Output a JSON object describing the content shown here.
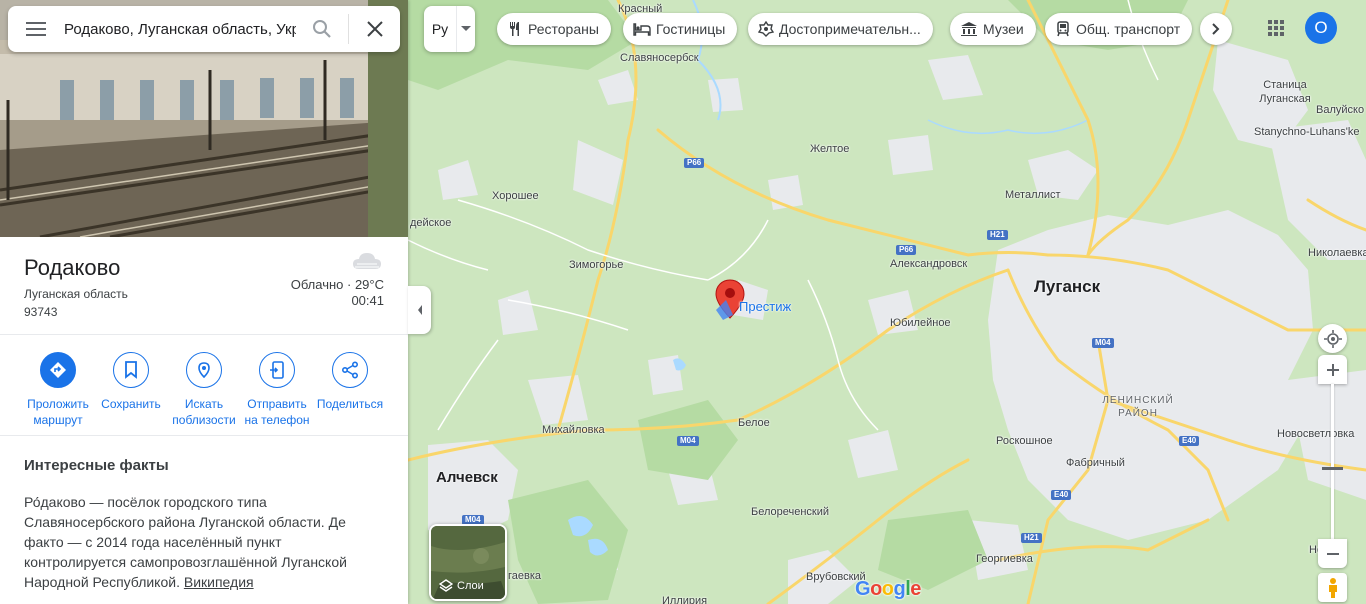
{
  "search": {
    "value": "Родаково, Луганская область, Украина",
    "menu_icon": "hamburger-icon",
    "search_icon": "search-icon",
    "close_icon": "close-icon"
  },
  "place": {
    "title": "Родаково",
    "region": "Луганская область",
    "postal_code": "93743",
    "weather_icon": "cloud-icon",
    "weather": "Облачно · 29°C",
    "time": "00:41"
  },
  "actions": [
    {
      "label": "Проложить маршрут",
      "icon": "directions-icon"
    },
    {
      "label": "Сохранить",
      "icon": "bookmark-icon"
    },
    {
      "label": "Искать поблизости",
      "icon": "nearby-icon"
    },
    {
      "label": "Отправить на телефон",
      "icon": "send-to-phone-icon"
    },
    {
      "label": "Поделиться",
      "icon": "share-icon"
    }
  ],
  "facts": {
    "title": "Интересные факты",
    "text": "Ро́даково — посёлок городского типа Славяносербского района Луганской области. Де факто — с 2014 года населённый пункт контролируется самопровозглашённой Луганской Народной Республикой.",
    "link": "Википедия"
  },
  "toolbar": {
    "language": "Ру",
    "chips": [
      {
        "label": "Рестораны",
        "icon": "restaurant-icon"
      },
      {
        "label": "Гостиницы",
        "icon": "hotel-icon"
      },
      {
        "label": "Достопримечательн...",
        "icon": "attraction-icon"
      },
      {
        "label": "Музеи",
        "icon": "museum-icon"
      },
      {
        "label": "Общ. транспорт",
        "icon": "transit-icon"
      }
    ],
    "avatar_letter": "О"
  },
  "map": {
    "poi": "Престиж",
    "labels": {
      "krasny": "Красный",
      "slavyanoserbsk": "Славяносербск",
      "stanitsa": "Станица Луганская",
      "valuyskoe": "Валуйско",
      "stanychno": "Stanychno-Luhans'ke",
      "zheltoe": "Желтое",
      "khoroshee": "Хорошее",
      "metallist": "Металлист",
      "deyskoe": "дейское",
      "zimogorye": "Зимогорье",
      "aleksandrovsk": "Александровск",
      "lugansk": "Луганск",
      "nikolaevka": "Николаевка",
      "yubileynoe": "Юбилейное",
      "leninsky": "ЛЕНИНСКИЙ РАЙОН",
      "mikhaylovka": "Михайловка",
      "beloe": "Белое",
      "roskoshnoe": "Роскошное",
      "novosvetlovka": "Новосветловка",
      "alchevsk": "Алчевск",
      "fabrichny": "Фабричный",
      "belorechensky": "Белореченский",
      "georgievka": "Георгиевка",
      "vrubovsky": "Врубовский",
      "gaevka": "гаевка",
      "illiriya": "Иллирия",
      "novo_edge": "Но"
    },
    "shields": [
      "Р66",
      "Р66",
      "H21",
      "M04",
      "M04",
      "M04",
      "E40",
      "E40",
      "H21"
    ],
    "layers_label": "Слои",
    "google_logo": "Google"
  },
  "colors": {
    "accent": "#1a73e8",
    "map_green": "#cde6bf",
    "urban": "#e8eaed",
    "road": "#f9d66b",
    "pin": "#ea4335"
  }
}
